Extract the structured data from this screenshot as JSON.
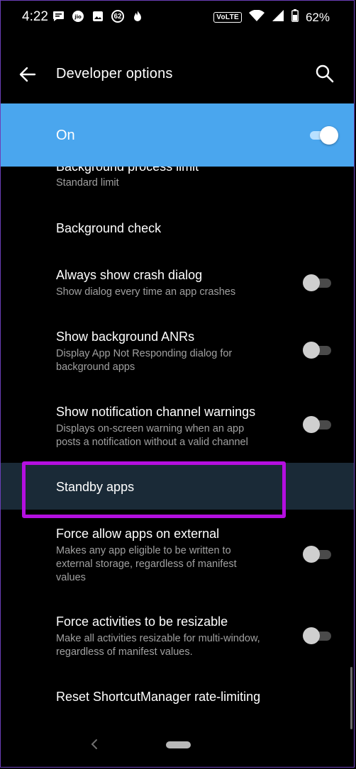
{
  "status_bar": {
    "time": "4:22",
    "notification_icons": [
      "chat-icon",
      "jio-icon",
      "gallery-icon",
      "aqi-62-icon",
      "tinder-flame-icon"
    ],
    "aqi_value": "62",
    "network_label": "VoLTE",
    "battery_percent": "62%"
  },
  "app_bar": {
    "title": "Developer options",
    "back_icon": "arrow-left-icon",
    "search_icon": "search-icon"
  },
  "master_switch": {
    "label": "On",
    "state": "on",
    "color": "#4aa6ee"
  },
  "settings": [
    {
      "title": "Background process limit",
      "subtitle": "Standard limit",
      "toggle": null
    },
    {
      "title": "Background check",
      "subtitle": "",
      "toggle": null
    },
    {
      "title": "Always show crash dialog",
      "subtitle": "Show dialog every time an app crashes",
      "toggle": "off"
    },
    {
      "title": "Show background ANRs",
      "subtitle": "Display App Not Responding dialog for background apps",
      "toggle": "off"
    },
    {
      "title": "Show notification channel warnings",
      "subtitle": "Displays on-screen warning when an app posts a notification without a valid channel",
      "toggle": "off"
    },
    {
      "title": "Standby apps",
      "subtitle": "",
      "toggle": null,
      "highlighted": true
    },
    {
      "title": "Force allow apps on external",
      "subtitle": "Makes any app eligible to be written to external storage, regardless of manifest values",
      "toggle": "off"
    },
    {
      "title": "Force activities to be resizable",
      "subtitle": "Make all activities resizable for multi-window, regardless of manifest values.",
      "toggle": "off"
    },
    {
      "title": "Reset ShortcutManager rate-limiting",
      "subtitle": "",
      "toggle": null
    }
  ],
  "highlight_color": "#b40fe0",
  "nav_bar": {
    "back_icon": "chevron-left-icon",
    "home_icon": "home-pill-icon"
  }
}
